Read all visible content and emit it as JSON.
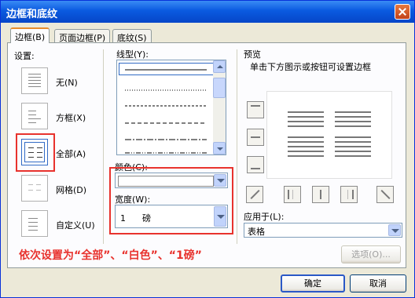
{
  "window": {
    "title": "边框和底纹"
  },
  "tabs": [
    {
      "label": "边框(B)"
    },
    {
      "label": "页面边框(P)"
    },
    {
      "label": "底纹(S)"
    }
  ],
  "settings": {
    "label": "设置:",
    "items": [
      {
        "label": "无(N)"
      },
      {
        "label": "方框(X)"
      },
      {
        "label": "全部(A)"
      },
      {
        "label": "网格(D)"
      },
      {
        "label": "自定义(U)"
      }
    ]
  },
  "line_style": {
    "label": "线型(Y):"
  },
  "color": {
    "label": "颜色(C):",
    "value": ""
  },
  "width": {
    "label": "宽度(W):",
    "value": "1      磅"
  },
  "preview": {
    "label": "预览",
    "hint": "单击下方图示或按钮可设置边框"
  },
  "apply_to": {
    "label": "应用于(L):",
    "value": "表格"
  },
  "options_button": "选项(O)...",
  "ok_button": "确定",
  "cancel_button": "取消",
  "annotation": "依次设置为“全部”、“白色”、“1磅”",
  "colors": {
    "accent": "#e8322d",
    "selection": "#316ac5"
  }
}
